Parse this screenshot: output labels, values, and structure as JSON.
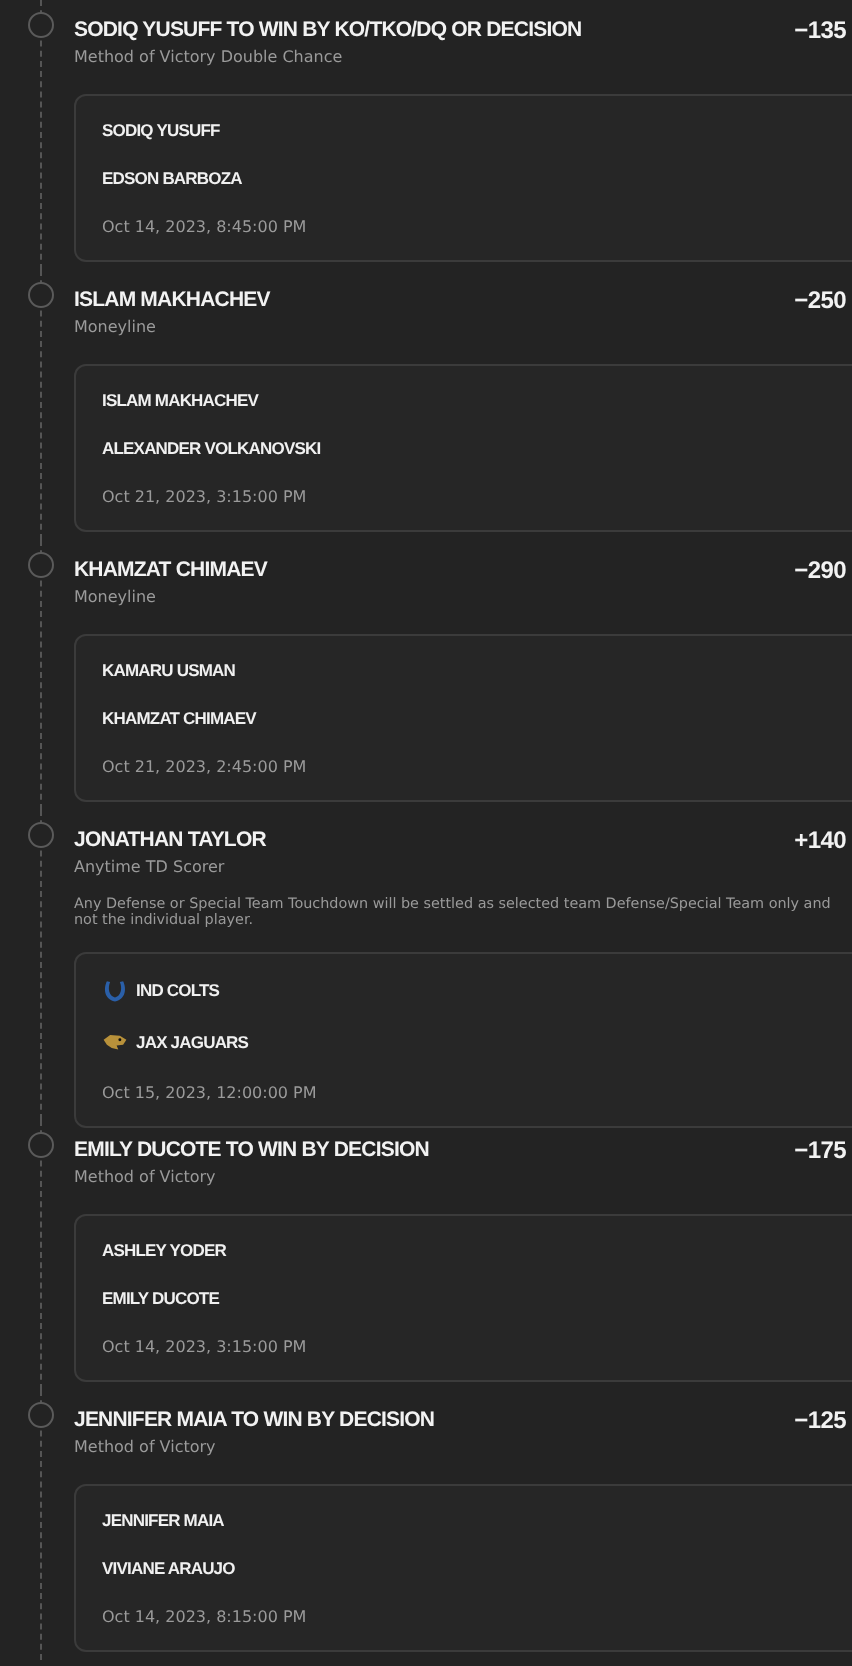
{
  "bets": [
    {
      "title": "SODIQ YUSUFF TO WIN BY KO/TKO/DQ OR DECISION",
      "odds": "−135",
      "market": "Method of Victory Double Chance",
      "legs": [
        {
          "name": "SODIQ YUSUFF"
        },
        {
          "name": "EDSON BARBOZA"
        }
      ],
      "date": "Oct 14, 2023, 8:45:00 PM"
    },
    {
      "title": "ISLAM MAKHACHEV",
      "odds": "−250",
      "market": "Moneyline",
      "legs": [
        {
          "name": "ISLAM MAKHACHEV"
        },
        {
          "name": "ALEXANDER VOLKANOVSKI"
        }
      ],
      "date": "Oct 21, 2023, 3:15:00 PM"
    },
    {
      "title": "KHAMZAT CHIMAEV",
      "odds": "−290",
      "market": "Moneyline",
      "legs": [
        {
          "name": "KAMARU USMAN"
        },
        {
          "name": "KHAMZAT CHIMAEV"
        }
      ],
      "date": "Oct 21, 2023, 2:45:00 PM"
    },
    {
      "title": "JONATHAN TAYLOR",
      "odds": "+140",
      "market": "Anytime TD Scorer",
      "note": "Any Defense or Special Team Touchdown will be settled as selected team Defense/Special Team only and not the individual player.",
      "legs": [
        {
          "name": "IND COLTS",
          "kind": "team",
          "color": "#2a5fa8"
        },
        {
          "name": "JAX JAGUARS",
          "kind": "team",
          "color": "#b8913a"
        }
      ],
      "date": "Oct 15, 2023, 12:00:00 PM"
    },
    {
      "title": "EMILY DUCOTE TO WIN BY DECISION",
      "odds": "−175",
      "market": "Method of Victory",
      "legs": [
        {
          "name": "ASHLEY YODER"
        },
        {
          "name": "EMILY DUCOTE"
        }
      ],
      "date": "Oct 14, 2023, 3:15:00 PM"
    },
    {
      "title": "JENNIFER MAIA TO WIN BY DECISION",
      "odds": "−125",
      "market": "Method of Victory",
      "legs": [
        {
          "name": "JENNIFER MAIA"
        },
        {
          "name": "VIVIANE ARAUJO"
        }
      ],
      "date": "Oct 14, 2023, 8:15:00 PM"
    }
  ]
}
